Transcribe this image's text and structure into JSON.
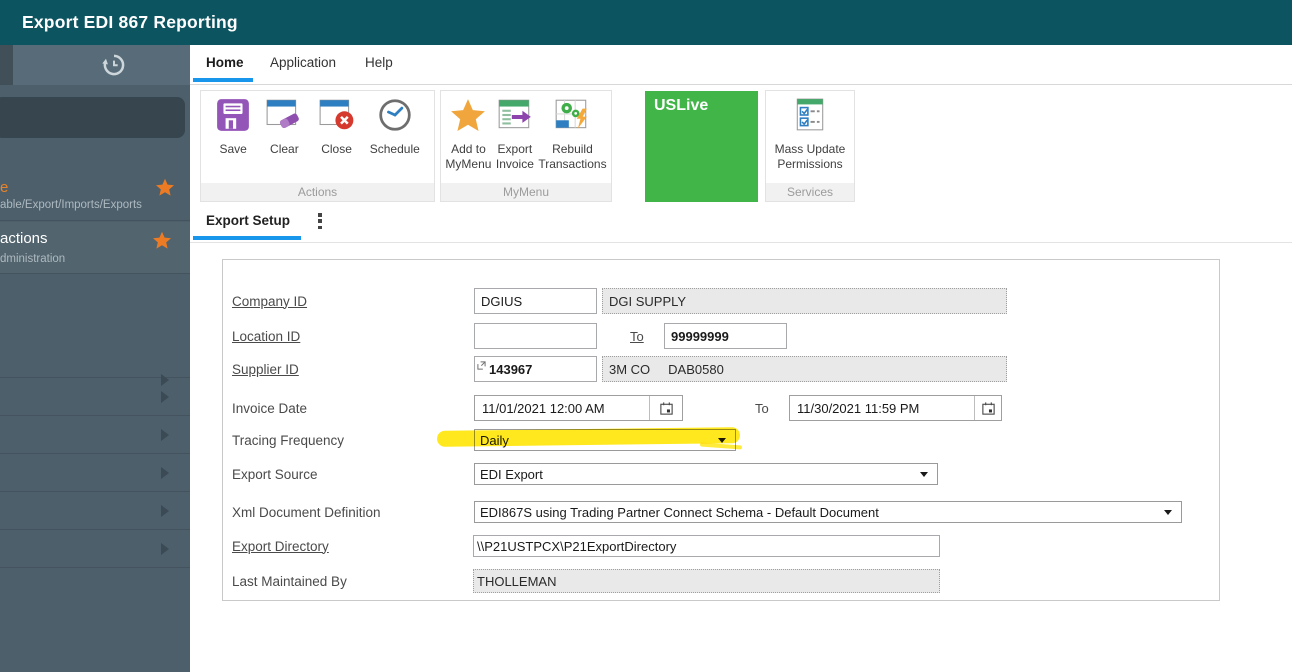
{
  "title_bar": {
    "title": "Export EDI 867 Reporting"
  },
  "menu_tabs": {
    "home": "Home",
    "application": "Application",
    "help": "Help"
  },
  "ribbon": {
    "actions_group": {
      "label": "Actions",
      "save": "Save",
      "clear": "Clear",
      "close": "Close",
      "schedule": "Schedule"
    },
    "mymenu_group": {
      "label": "MyMenu",
      "add_to_mymenu_line1": "Add to",
      "add_to_mymenu_line2": "MyMenu",
      "export_invoice_line1": "Export",
      "export_invoice_line2": "Invoice",
      "rebuild_transactions_line1": "Rebuild",
      "rebuild_transactions_line2": "Transactions"
    },
    "environment_tile": {
      "label": "USLive"
    },
    "services_group": {
      "label": "Services",
      "mass_update_line1": "Mass Update",
      "mass_update_line2": "Permissions"
    }
  },
  "sidebar": {
    "items": [
      {
        "title": "e",
        "subtitle": "able/Export/Imports/Exports"
      },
      {
        "title": "actions",
        "subtitle": "dministration"
      }
    ]
  },
  "page_tabs": {
    "export_setup": "Export Setup"
  },
  "form": {
    "company_id": {
      "label": "Company ID",
      "value": "DGIUS",
      "name": "DGI SUPPLY"
    },
    "location_id": {
      "label": "Location ID",
      "from": "",
      "to_label": "To",
      "to": "99999999"
    },
    "supplier_id": {
      "label": "Supplier ID",
      "value": "143967",
      "name": "3M CO",
      "code": "DAB0580"
    },
    "invoice_date": {
      "label": "Invoice Date",
      "from": "11/01/2021 12:00 AM",
      "to_label": "To",
      "to": "11/30/2021 11:59 PM"
    },
    "tracing_frequency": {
      "label": "Tracing Frequency",
      "value": "Daily"
    },
    "export_source": {
      "label": "Export Source",
      "value": "EDI Export"
    },
    "xml_document_definition": {
      "label": "Xml Document Definition",
      "value": "EDI867S using Trading Partner Connect Schema - Default Document"
    },
    "export_directory": {
      "label": "Export Directory",
      "value": "\\\\P21USTPCX\\P21ExportDirectory"
    },
    "last_maintained_by": {
      "label": "Last Maintained By",
      "value": "THOLLEMAN"
    }
  },
  "colors": {
    "title_bar_teal": "#0b5460",
    "accent_blue": "#1896ec",
    "environment_green": "#42b549",
    "highlight_yellow": "#ffe60a",
    "favorite_orange": "#ed7b23"
  }
}
